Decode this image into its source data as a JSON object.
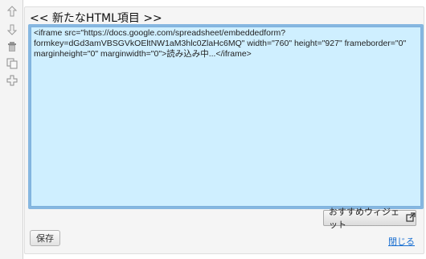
{
  "panel": {
    "title": "<< 新たなHTML項目 >>"
  },
  "editor": {
    "value": "<iframe src=\"https://docs.google.com/spreadsheet/embeddedform?formkey=dGd3amVBSGVkOEltNW1aM3hlc0ZlaHc6MQ\" width=\"760\" height=\"927\" frameborder=\"0\" marginheight=\"0\" marginwidth=\"0\">読み込み中...</iframe>"
  },
  "widget_button": {
    "label": "おすすめウィジェット",
    "icon": "external-link-icon"
  },
  "save_button": {
    "label": "保存"
  },
  "close_link": {
    "label": "閉じる"
  },
  "toolbar": {
    "icons": [
      "arrow-up-icon",
      "arrow-down-icon",
      "trash-icon",
      "copy-icon",
      "add-icon"
    ]
  },
  "colors": {
    "editor_bg": "#cfefff",
    "editor_border": "#86b7e0",
    "link": "#1a6fd1"
  }
}
